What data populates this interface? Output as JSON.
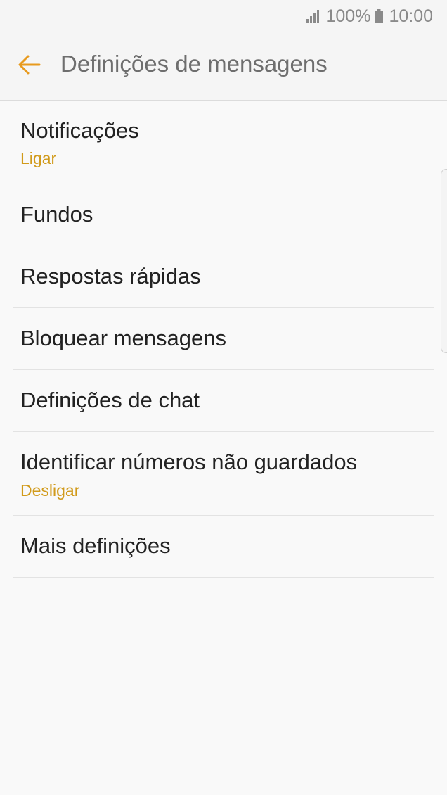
{
  "status_bar": {
    "battery_percent": "100%",
    "time": "10:00",
    "icons": [
      "signal-icon",
      "battery-icon"
    ]
  },
  "header": {
    "title": "Definições de mensagens",
    "back_icon": "arrow-left-icon"
  },
  "colors": {
    "accent": "#e89a1e",
    "subtitle": "#d19a1a",
    "title_text": "#222222",
    "header_text": "#6e6e6e",
    "background": "#f9f9f9"
  },
  "settings": [
    {
      "title": "Notificações",
      "subtitle": "Ligar"
    },
    {
      "title": "Fundos"
    },
    {
      "title": "Respostas rápidas"
    },
    {
      "title": "Bloquear mensagens"
    },
    {
      "title": "Definições de chat"
    },
    {
      "title": "Identificar números não guardados",
      "subtitle": "Desligar"
    },
    {
      "title": "Mais definições"
    }
  ]
}
